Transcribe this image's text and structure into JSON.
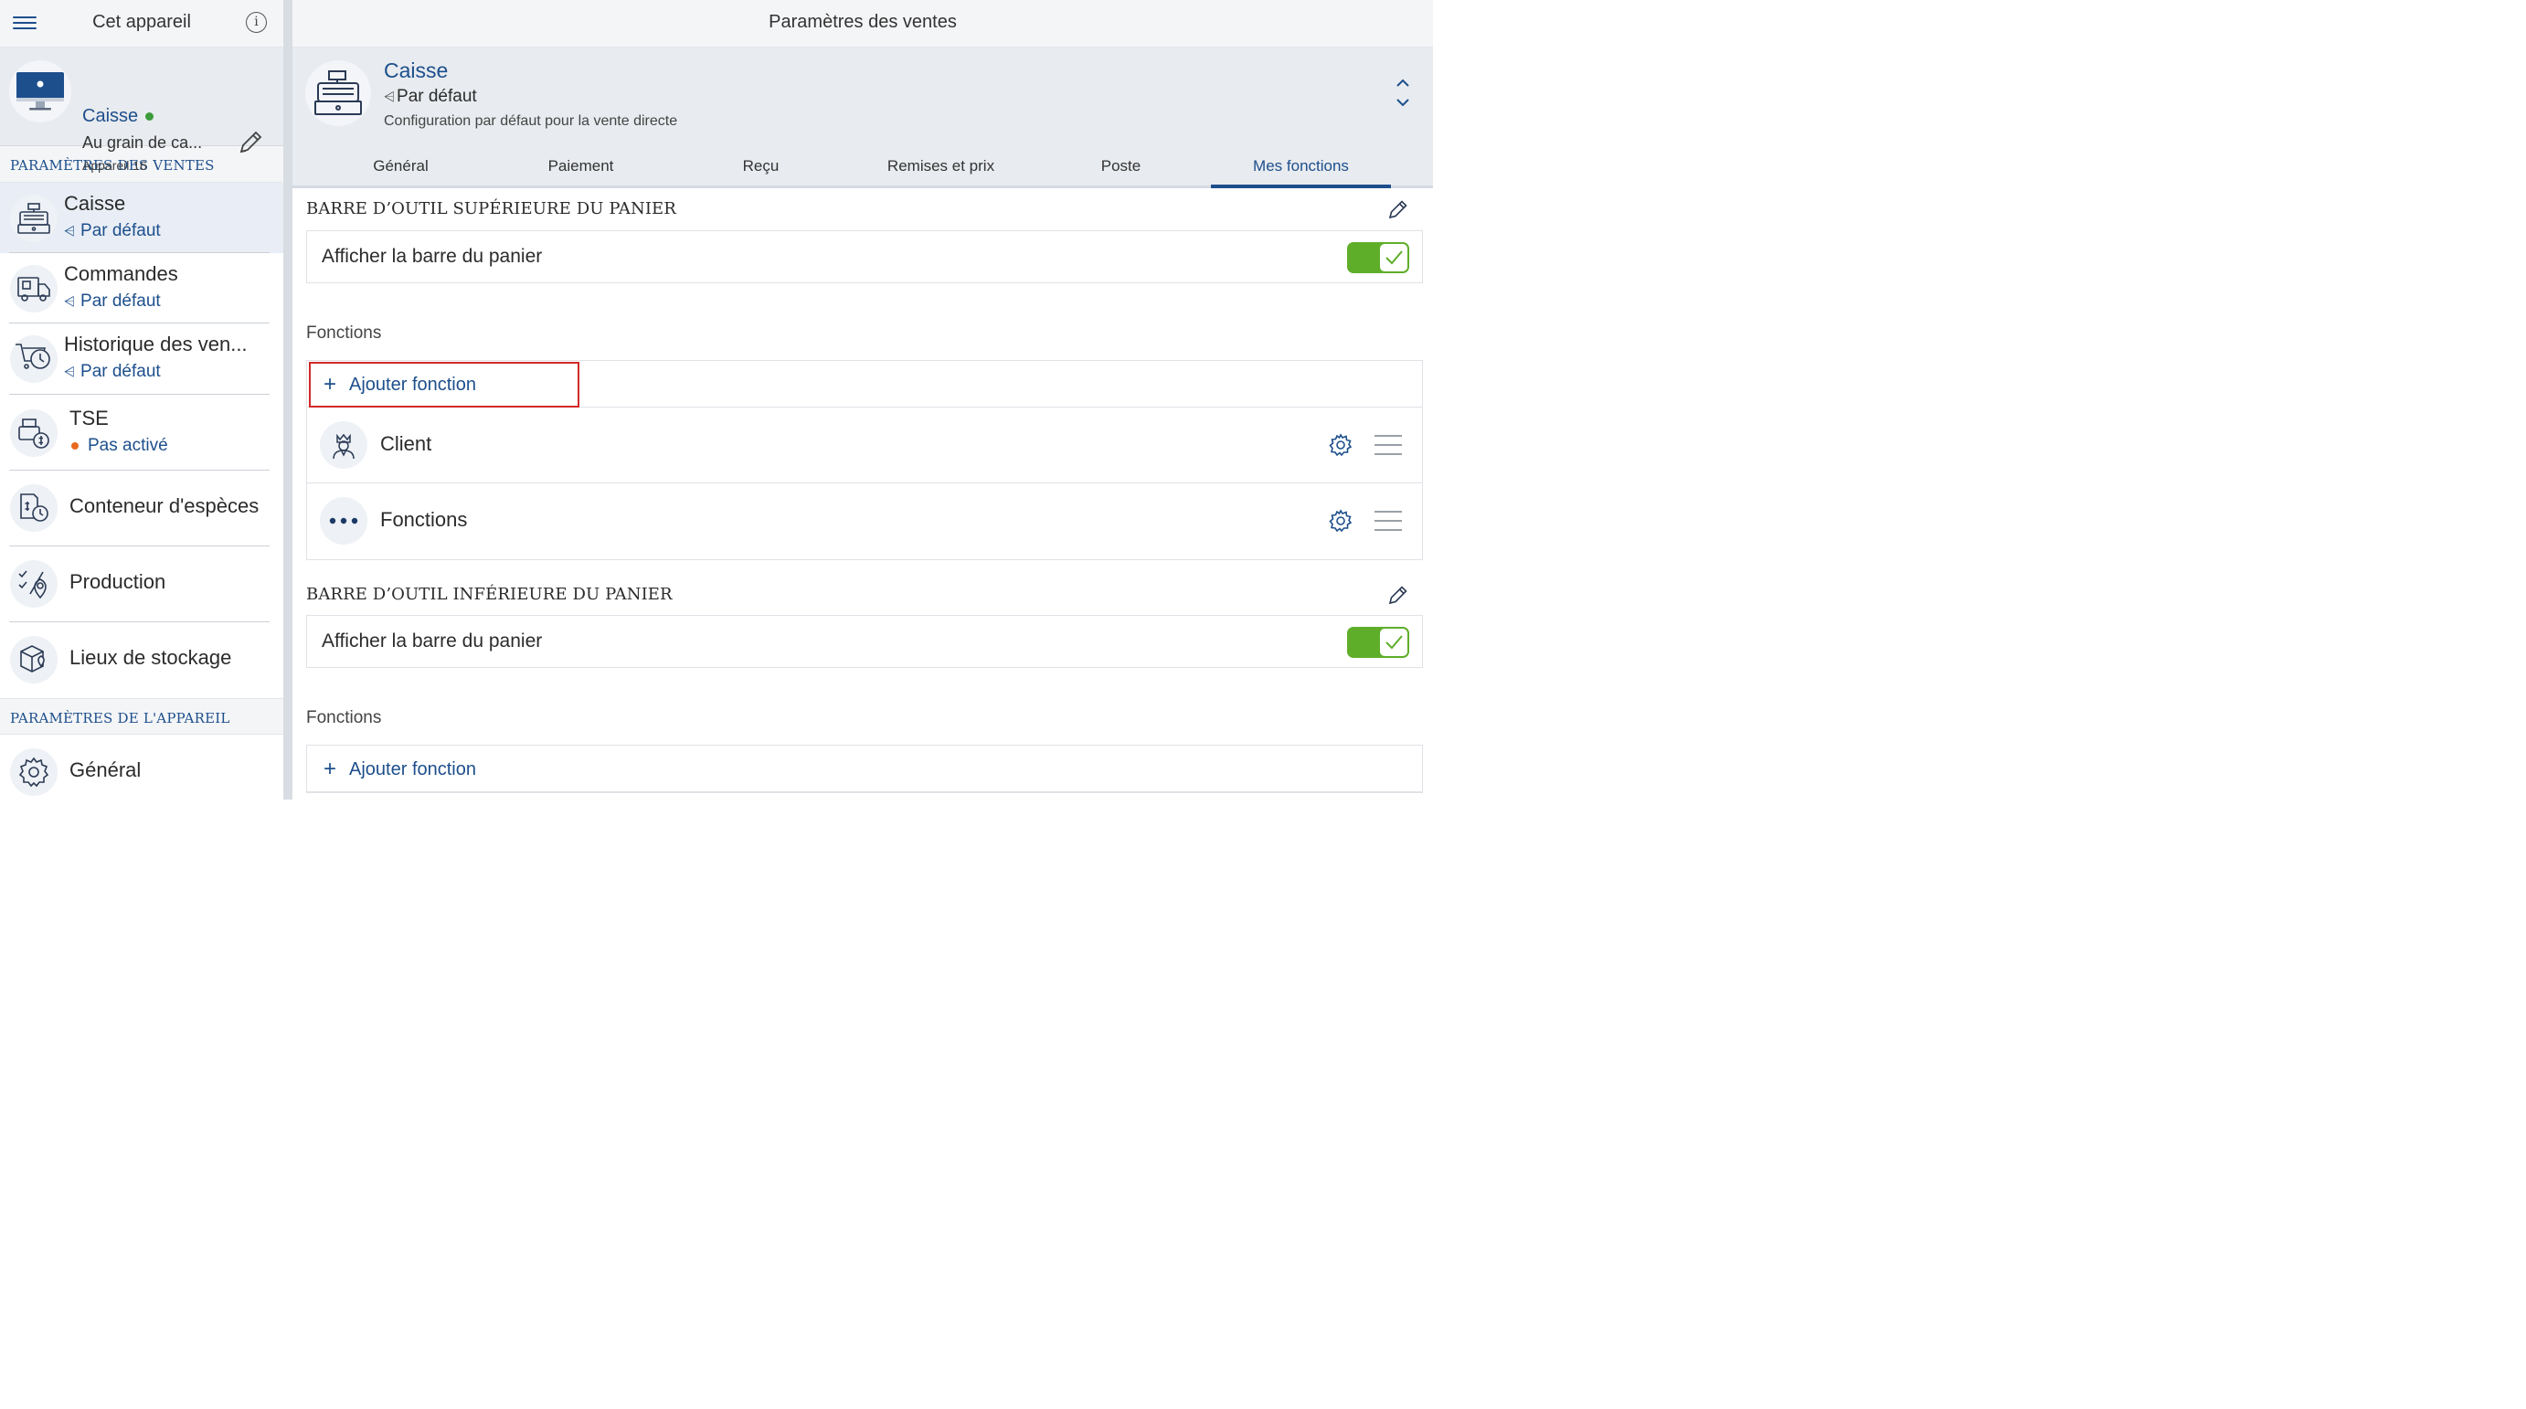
{
  "sidebar": {
    "header_title": "Cet appareil",
    "device": {
      "name": "Caisse",
      "subtitle": "Au grain de ca...",
      "meta": "Appareil 16",
      "status_color": "#3c9b3c"
    },
    "section_sales": "PARAMÈTRES DES VENTES",
    "items": [
      {
        "title": "Caisse",
        "sub": "Par défaut",
        "icon": "cash-register-icon",
        "active": true
      },
      {
        "title": "Commandes",
        "sub": "Par défaut",
        "icon": "delivery-truck-icon"
      },
      {
        "title": "Historique des ven...",
        "sub": "Par défaut",
        "icon": "cart-history-icon"
      },
      {
        "title": "TSE",
        "sub": "Pas activé",
        "icon": "tse-icon",
        "status_color": "#e8691e"
      },
      {
        "title": "Conteneur d'espèces",
        "icon": "cash-container-icon"
      },
      {
        "title": "Production",
        "icon": "production-icon"
      },
      {
        "title": "Lieux de stockage",
        "icon": "storage-icon"
      }
    ],
    "section_device": "PARAMÈTRES DE L'APPAREIL",
    "device_items": [
      {
        "title": "Général",
        "icon": "gear-icon"
      }
    ]
  },
  "main": {
    "header_title": "Paramètres des ventes",
    "config": {
      "title": "Caisse",
      "subtitle": "Par défaut",
      "description": "Configuration par défaut pour la vente directe"
    },
    "tabs": [
      {
        "label": "Général"
      },
      {
        "label": "Paiement"
      },
      {
        "label": "Reçu"
      },
      {
        "label": "Remises et prix"
      },
      {
        "label": "Poste"
      },
      {
        "label": "Mes fonctions",
        "active": true
      }
    ],
    "top_bar": {
      "title": "BARRE D’OUTIL SUPÉRIEURE DU PANIER",
      "toggle_label": "Afficher la barre du panier",
      "toggle_on": true,
      "functions_label": "Fonctions",
      "add_label": "Ajouter fonction",
      "functions": [
        {
          "name": "Client",
          "icon": "client-icon"
        },
        {
          "name": "Fonctions",
          "icon": "more-dots-icon"
        }
      ]
    },
    "bottom_bar": {
      "title": "BARRE D’OUTIL INFÉRIEURE DU PANIER",
      "toggle_label": "Afficher la barre du panier",
      "toggle_on": true,
      "functions_label": "Fonctions",
      "add_label": "Ajouter fonction"
    }
  },
  "colors": {
    "accent": "#1d4f8c",
    "toggle_on": "#5fae2a",
    "highlight_border": "#d22a2a"
  }
}
